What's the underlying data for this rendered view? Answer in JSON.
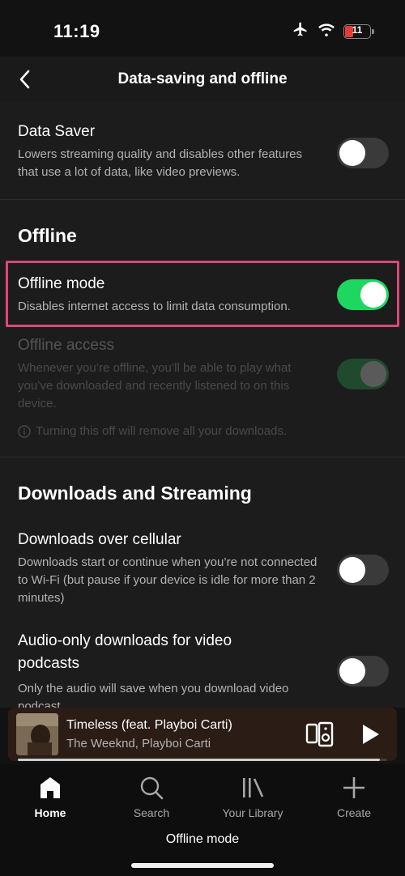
{
  "status_bar": {
    "time": "11:19",
    "battery_level": "11"
  },
  "header": {
    "title": "Data-saving and offline"
  },
  "data_saver": {
    "title": "Data Saver",
    "description": "Lowers streaming quality and disables other features that use a lot of data, like video previews.",
    "enabled": false
  },
  "offline_section": {
    "title": "Offline",
    "offline_mode": {
      "title": "Offline mode",
      "description": "Disables internet access to limit data consumption.",
      "enabled": true
    },
    "offline_access": {
      "title": "Offline access",
      "description": "Whenever you’re offline, you’ll be able to play what you’ve downloaded and recently listened to on this device.",
      "note": "Turning this off will remove all your downloads.",
      "enabled": true,
      "disabled_state": true
    }
  },
  "downloads_section": {
    "title": "Downloads and Streaming",
    "cellular": {
      "title": "Downloads over cellular",
      "description": "Downloads start or continue when you’re not connected to Wi-Fi (but pause if your device is idle for more than 2 minutes)",
      "enabled": false
    },
    "audio_only": {
      "title": "Audio-only downloads for video podcasts",
      "description": "Only the audio will save when you download video podcast",
      "enabled": false
    }
  },
  "now_playing": {
    "track": "Timeless (feat. Playboi Carti)",
    "artist": "The Weeknd, Playboi Carti",
    "progress": 0.98
  },
  "tabs": [
    {
      "label": "Home",
      "icon": "home-icon",
      "active": true
    },
    {
      "label": "Search",
      "icon": "search-icon",
      "active": false
    },
    {
      "label": "Your Library",
      "icon": "library-icon",
      "active": false
    },
    {
      "label": "Create",
      "icon": "plus-icon",
      "active": false
    }
  ],
  "offline_banner": "Offline mode",
  "colors": {
    "accent_green": "#1ed760",
    "highlight_pink": "#e0457b",
    "background": "#121212"
  }
}
